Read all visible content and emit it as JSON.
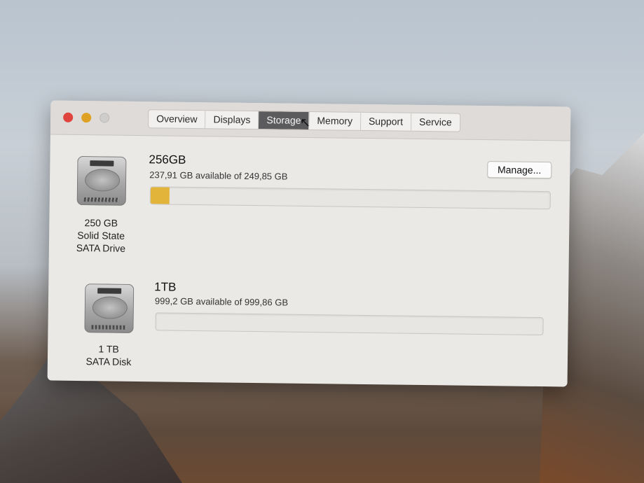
{
  "window": {
    "tabs": [
      {
        "label": "Overview"
      },
      {
        "label": "Displays"
      },
      {
        "label": "Storage"
      },
      {
        "label": "Memory"
      },
      {
        "label": "Support"
      },
      {
        "label": "Service"
      }
    ],
    "active_tab": "Storage"
  },
  "drives": [
    {
      "icon": "hard-drive-icon",
      "caption_lines": [
        "250 GB",
        "Solid State",
        "SATA Drive"
      ],
      "name": "256GB",
      "availability": "237,91 GB available of 249,85 GB",
      "used_fraction": 0.048,
      "manage_label": "Manage...",
      "fill_color": "#e2b53a"
    },
    {
      "icon": "hard-drive-icon",
      "caption_lines": [
        "1 TB",
        "SATA Disk"
      ],
      "name": "1TB",
      "availability": "999,2 GB available of 999,86 GB",
      "used_fraction": 0.0007
    }
  ]
}
